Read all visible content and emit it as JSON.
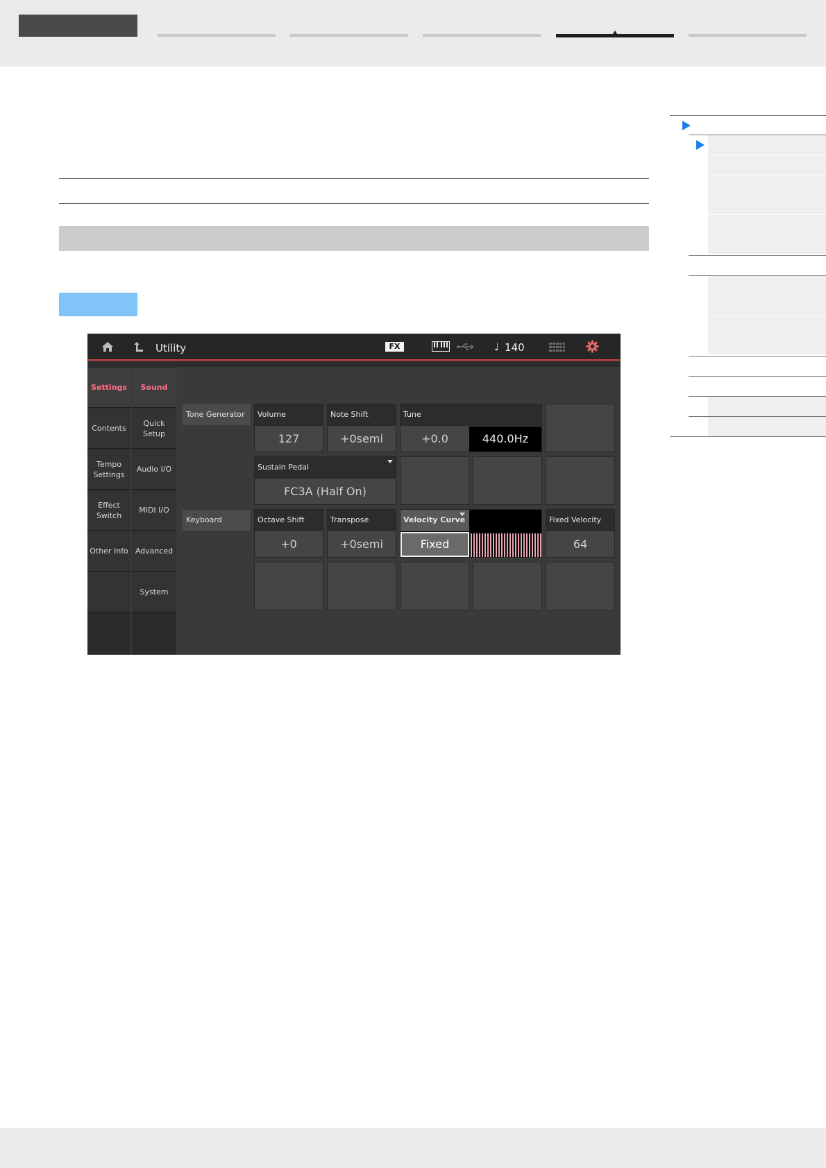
{
  "screen": {
    "title": "Utility",
    "fx_label": "FX",
    "tempo_symbol": "♩",
    "tempo": "140",
    "left_tabs": [
      "Settings",
      "Contents",
      "Tempo Settings",
      "Effect Switch",
      "Other Info"
    ],
    "sub_tabs": [
      "Sound",
      "Quick Setup",
      "Audio I/O",
      "MIDI I/O",
      "Advanced",
      "System"
    ],
    "sections": {
      "tone_generator": "Tone Generator",
      "keyboard": "Keyboard"
    },
    "params": {
      "volume": {
        "label": "Volume",
        "value": "127"
      },
      "note_shift": {
        "label": "Note Shift",
        "value": "+0semi"
      },
      "tune": {
        "label": "Tune",
        "value": "+0.0",
        "hz": "440.0Hz"
      },
      "sustain_pedal": {
        "label": "Sustain Pedal",
        "value": "FC3A (Half On)"
      },
      "octave_shift": {
        "label": "Octave Shift",
        "value": "+0"
      },
      "transpose": {
        "label": "Transpose",
        "value": "+0semi"
      },
      "velocity_curve": {
        "label": "Velocity Curve",
        "value": "Fixed"
      },
      "fixed_velocity": {
        "label": "Fixed Velocity",
        "value": "64"
      }
    },
    "colors": {
      "accent_pink": "#ff6f86",
      "red_line": "#d04040",
      "index_arrow": "#1a7fe8",
      "tag_blue": "#80c4f8"
    },
    "icons": [
      "home-icon",
      "back-arrow-icon",
      "keyboard-icon",
      "usb-icon",
      "note-icon",
      "grid-icon",
      "gear-icon"
    ]
  }
}
